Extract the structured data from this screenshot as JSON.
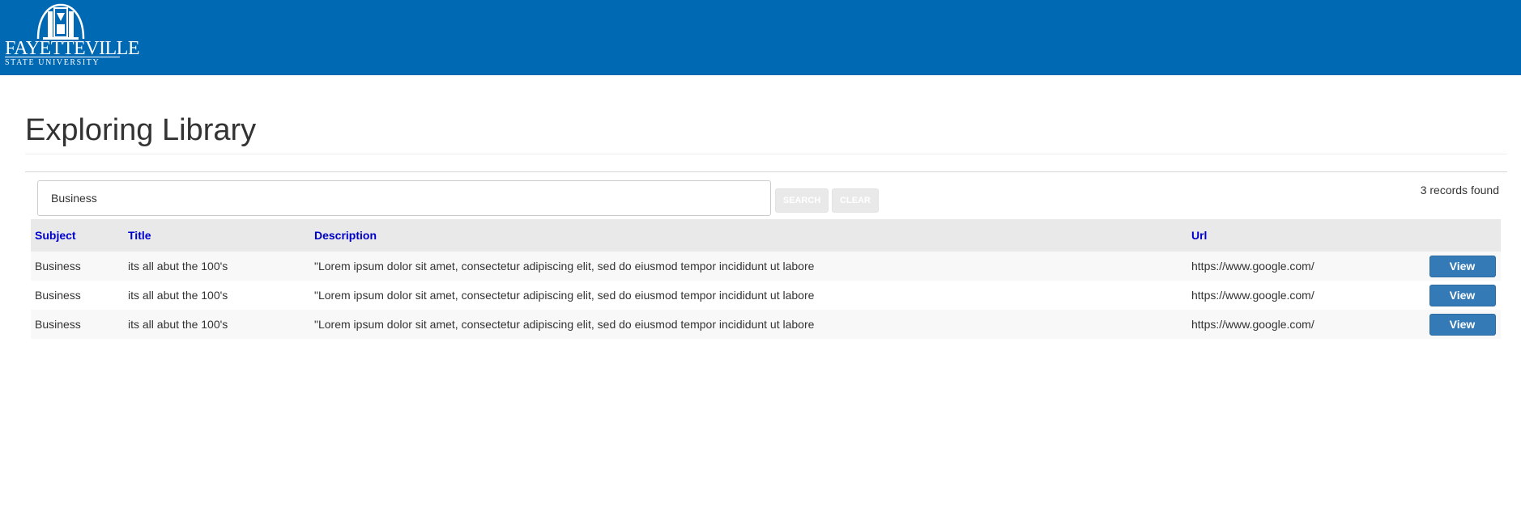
{
  "brand": {
    "name": "FAYETTEVILLE",
    "subtitle": "STATE UNIVERSITY",
    "header_color": "#0069b4",
    "logo_icon": "university-seal-icon"
  },
  "page": {
    "title": "Exploring Library"
  },
  "search": {
    "value": "Business",
    "search_label": "SEARCH",
    "clear_label": "CLEAR",
    "records_text": "3 records found"
  },
  "table": {
    "headers": {
      "subject": "Subject",
      "title": "Title",
      "description": "Description",
      "url": "Url"
    },
    "header_color": "#0000cc",
    "rows": [
      {
        "subject": "Business",
        "title": "its all abut the 100's",
        "description": "\"Lorem ipsum dolor sit amet, consectetur adipiscing elit, sed do eiusmod tempor incididunt ut labore",
        "url": "https://www.google.com/",
        "action": "View"
      },
      {
        "subject": "Business",
        "title": "its all abut the 100's",
        "description": "\"Lorem ipsum dolor sit amet, consectetur adipiscing elit, sed do eiusmod tempor incididunt ut labore",
        "url": "https://www.google.com/",
        "action": "View"
      },
      {
        "subject": "Business",
        "title": "its all abut the 100's",
        "description": "\"Lorem ipsum dolor sit amet, consectetur adipiscing elit, sed do eiusmod tempor incididunt ut labore",
        "url": "https://www.google.com/",
        "action": "View"
      }
    ],
    "view_button_color": "#337ab7"
  }
}
